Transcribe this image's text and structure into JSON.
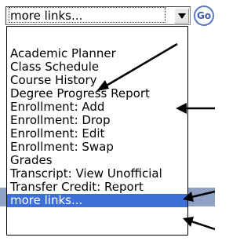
{
  "select": {
    "value": "more links...",
    "icon": "chevron-down-icon"
  },
  "go_button": {
    "label": "Go"
  },
  "dropdown": {
    "options": [
      "Academic Planner",
      "Class Schedule",
      "Course History",
      "Degree Progress Report",
      "Enrollment: Add",
      "Enrollment: Drop",
      "Enrollment: Edit",
      "Enrollment: Swap",
      "Grades",
      "Transcript: View Unofficial",
      "Transfer Credit: Report",
      "more links..."
    ],
    "selected_index": 11
  },
  "colors": {
    "selected_background": "#3c6fd8",
    "go_button": "#5b78c4",
    "background_band": "#8fa1c4"
  },
  "callout_arrows": {
    "count": 4,
    "icon": "arrow-icon"
  }
}
